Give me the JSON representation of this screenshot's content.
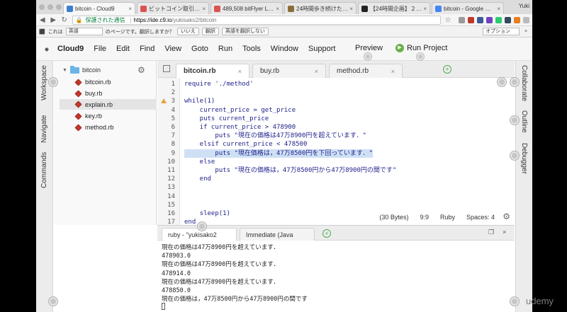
{
  "browser": {
    "profile": "Yuki",
    "tabs": [
      {
        "label": "bitcoin - Cloud9",
        "color": "#3c7fd1",
        "active": true
      },
      {
        "label": "ビットコイン取引所【bitFlyer",
        "color": "#d9534f",
        "active": false
      },
      {
        "label": "489,508 bitFlyer Lightning",
        "color": "#d9534f",
        "active": false
      },
      {
        "label": "24時間歩き続けた。ぶっとん",
        "color": "#8a6d3b",
        "active": false
      },
      {
        "label": "【24時間企画】２４時間ひ",
        "color": "#222222",
        "active": false
      },
      {
        "label": "bitcoin - Google 検索",
        "color": "#4285f4",
        "active": false
      }
    ],
    "address": {
      "secure_label": "保護された通信",
      "url_host": "https://ide.c9.io",
      "url_path": "/yukisako2/bitcoin"
    },
    "translate_bar": {
      "prefix": "これは",
      "language": "英語",
      "question": "のページです。翻訳しますか？",
      "no": "いいえ",
      "translate": "翻訳",
      "never": "英語を翻訳しない",
      "options": "オプション"
    }
  },
  "menu": {
    "brand": "Cloud9",
    "items": [
      "File",
      "Edit",
      "Find",
      "View",
      "Goto",
      "Run",
      "Tools",
      "Window",
      "Support"
    ],
    "preview": "Preview",
    "run_project": "Run Project"
  },
  "left_panels": [
    "Workspace",
    "Navigate",
    "Commands"
  ],
  "right_panels": [
    "Collaborate",
    "Outline",
    "Debugger"
  ],
  "tree": {
    "root": "bitcoin",
    "files": [
      "bitcoin.rb",
      "buy.rb",
      "explain.rb",
      "key.rb",
      "method.rb"
    ],
    "selected": "explain.rb"
  },
  "editor_tabs": [
    "bitcoin.rb",
    "buy.rb",
    "method.rb"
  ],
  "code": [
    {
      "n": "1",
      "text": "require './method'"
    },
    {
      "n": "2",
      "text": ""
    },
    {
      "n": "3",
      "text": "while(1)"
    },
    {
      "n": "4",
      "text": "    current_price = get_price"
    },
    {
      "n": "5",
      "text": "    puts current_price"
    },
    {
      "n": "6",
      "text": "    if current_price > 478900"
    },
    {
      "n": "7",
      "text": "        puts \"現在の価格は47万8900円を超えています．\""
    },
    {
      "n": "8",
      "text": "    elsif current_price < 478500"
    },
    {
      "n": "9",
      "text": "        puts \"現在価格は，47万8500円を下回っています．\""
    },
    {
      "n": "10",
      "text": "    else"
    },
    {
      "n": "11",
      "text": "        puts \"現在の価格は，47万8500円から47万8900円の間です\""
    },
    {
      "n": "12",
      "text": "    end"
    },
    {
      "n": "13",
      "text": ""
    },
    {
      "n": "14",
      "text": ""
    },
    {
      "n": "15",
      "text": ""
    },
    {
      "n": "16",
      "text": "    sleep(1)"
    },
    {
      "n": "17",
      "text": "end"
    }
  ],
  "status": {
    "bytes": "(30 Bytes)",
    "position": "9:9",
    "language": "Ruby",
    "spaces": "Spaces: 4"
  },
  "console_tabs": [
    "ruby - \"yukisako2",
    "Immediate (Java"
  ],
  "console_lines": [
    "現在の価格は47万8900円を超えています．",
    "478903.0",
    "現在の価格は47万8900円を超えています．",
    "478914.0",
    "現在の価格は47万8900円を超えています．",
    "478850.0",
    "現在の価格は，47万8500円から47万8900円の間です"
  ],
  "watermark": "udemy"
}
